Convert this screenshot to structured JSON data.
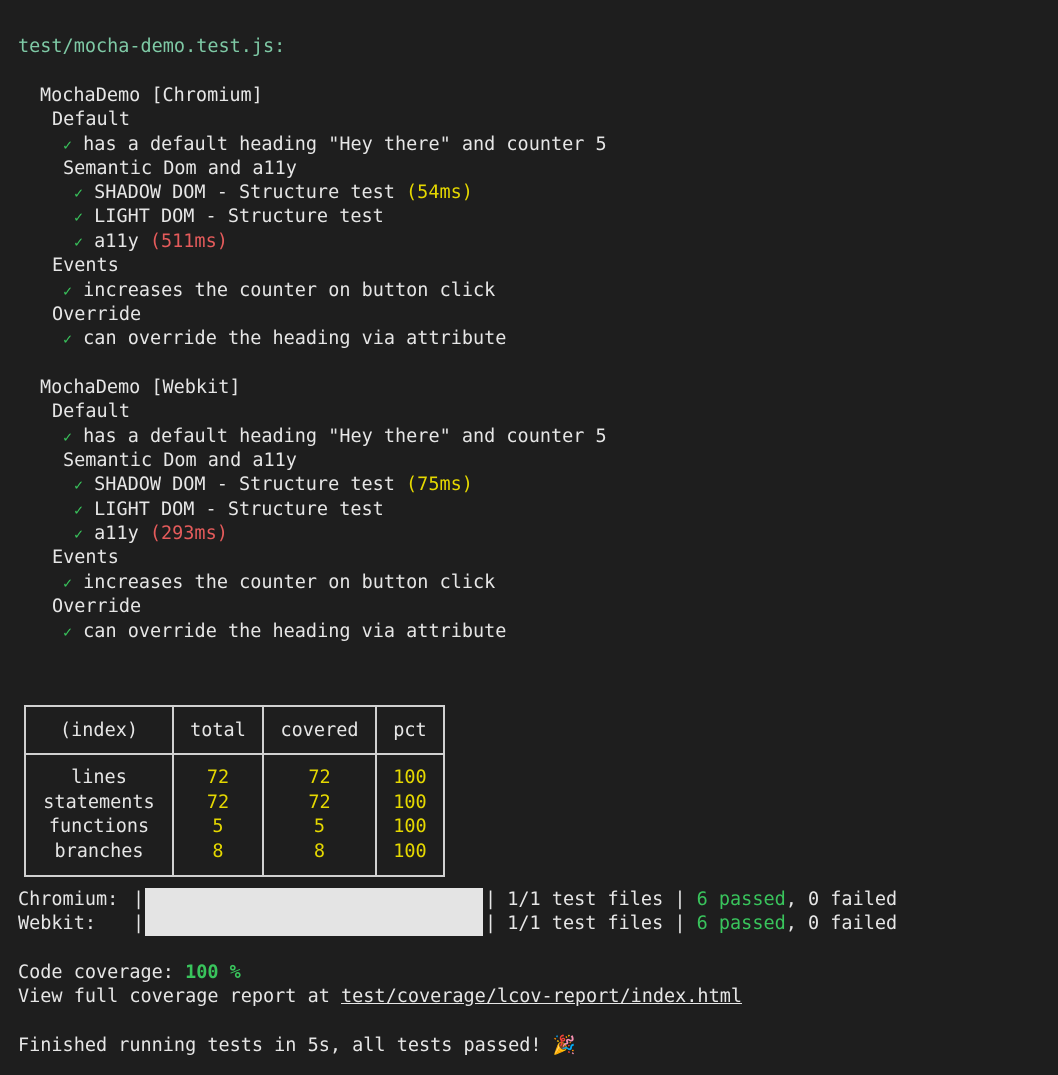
{
  "file_header": "test/mocha-demo.test.js:",
  "suites": [
    {
      "title": "MochaDemo [Chromium]",
      "default_label": "Default",
      "default_test": "has a default heading \"Hey there\" and counter 5",
      "semantic_label": "Semantic Dom and a11y",
      "shadow_test": "SHADOW DOM - Structure test",
      "shadow_time": "(54ms)",
      "light_test": "LIGHT DOM - Structure test",
      "a11y_test": "a11y",
      "a11y_time": "(511ms)",
      "events_label": "Events",
      "events_test": "increases the counter on button click",
      "override_label": "Override",
      "override_test": "can override the heading via attribute"
    },
    {
      "title": "MochaDemo [Webkit]",
      "default_label": "Default",
      "default_test": "has a default heading \"Hey there\" and counter 5",
      "semantic_label": "Semantic Dom and a11y",
      "shadow_test": "SHADOW DOM - Structure test",
      "shadow_time": "(75ms)",
      "light_test": "LIGHT DOM - Structure test",
      "a11y_test": "a11y",
      "a11y_time": "(293ms)",
      "events_label": "Events",
      "events_test": "increases the counter on button click",
      "override_label": "Override",
      "override_test": "can override the heading via attribute"
    }
  ],
  "check_glyph": "✓",
  "coverage_table": {
    "headers": [
      "(index)",
      "total",
      "covered",
      "pct"
    ],
    "rows": [
      {
        "index": "lines",
        "total": "72",
        "covered": "72",
        "pct": "100"
      },
      {
        "index": "statements",
        "total": "72",
        "covered": "72",
        "pct": "100"
      },
      {
        "index": "functions",
        "total": "5",
        "covered": "5",
        "pct": "100"
      },
      {
        "index": "branches",
        "total": "8",
        "covered": "8",
        "pct": "100"
      }
    ]
  },
  "progress": [
    {
      "browser": "Chromium:",
      "progress": 1.0,
      "files": "| 1/1 test files |",
      "passed": "6 passed",
      "sep": ",",
      "failed": "0 failed"
    },
    {
      "browser": "Webkit:",
      "progress": 1.0,
      "files": "| 1/1 test files |",
      "passed": "6 passed",
      "sep": ",",
      "failed": "0 failed"
    }
  ],
  "coverage": {
    "label": "Code coverage:",
    "value": "100 %",
    "report_prefix": "View full coverage report at",
    "report_path": "test/coverage/lcov-report/index.html"
  },
  "finished": {
    "text": "Finished running tests in 5s, all tests passed!",
    "emoji": "🎉"
  },
  "colors": {
    "background": "#1e1e1e",
    "pass_green": "#39c45c",
    "slow_yellow": "#e5d800",
    "very_slow_red": "#e55b5b",
    "path_cyan": "#7ec9a5"
  }
}
